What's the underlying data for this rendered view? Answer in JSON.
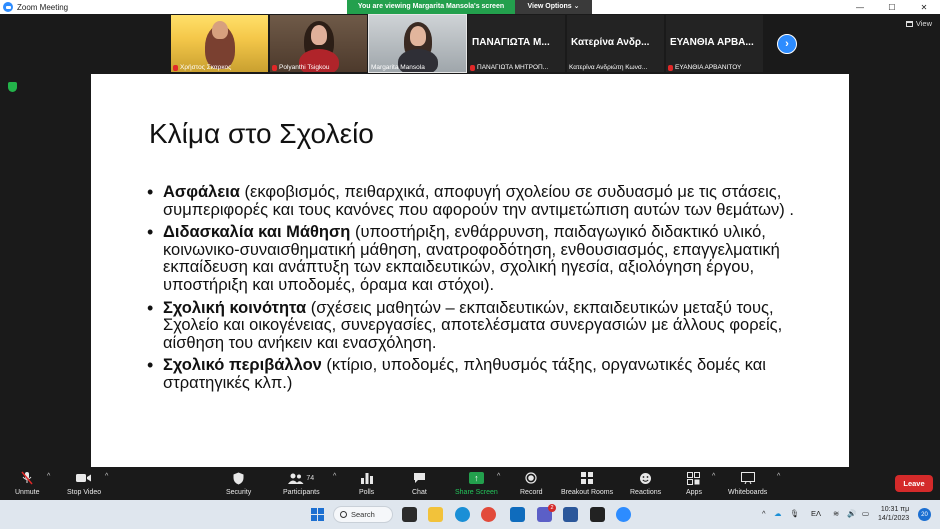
{
  "window": {
    "title": "Zoom Meeting",
    "controls": [
      "—",
      "☐",
      "✕"
    ]
  },
  "share_banner": {
    "text": "You are viewing Margarita Mansola's screen",
    "view_options": "View Options ⌄"
  },
  "view_button": "View",
  "participants": [
    {
      "name": "Χρήστος Σκαρκος",
      "muted": true,
      "type": "video"
    },
    {
      "name": "Polyanthi Tsigkou",
      "muted": true,
      "type": "video"
    },
    {
      "name": "Margarita Mansola",
      "muted": false,
      "type": "video"
    },
    {
      "big": "ΠΑΝΑΓΙΩΤΑ  Μ...",
      "name": "ΠΑΝΑΓΙΩΤΑ ΜΗΤΡΟΠ...",
      "muted": true,
      "type": "name"
    },
    {
      "big": "Κατερίνα Ανδρ...",
      "name": "Κατερίνα Ανδριώτη Κωνσ...",
      "muted": false,
      "type": "name"
    },
    {
      "big": "ΕΥΑΝΘΙΑ  ΑΡΒΑ...",
      "name": "ΕΥΑΝΘΙΑ ΑΡΒΑΝΙΤΟΥ",
      "muted": true,
      "type": "name"
    }
  ],
  "slide": {
    "title": "Κλίμα στο Σχολείο",
    "bullets": [
      {
        "head": "Ασφάλεια",
        "body": " (εκφοβισμός, πειθαρχικά,  αποφυγή σχολείου σε συδυασμό με τις  στάσεις, συμπεριφορές και τους κανόνες που αφορούν την αντιμετώπιση αυτών των θεμάτων) ."
      },
      {
        "head": "Διδασκαλία και Μάθηση",
        "body": " (υποστήριξη, ενθάρρυνση,  παιδαγωγικό διδακτικό υλικό, κοινωνικο-συναισθηματική μάθηση, ανατροφοδότηση, ενθουσιασμός, επαγγελματική εκπαίδευση και ανάπτυξη των εκπαιδευτικών,  σχολική ηγεσία,  αξιολόγηση έργου, υποστήριξη και υποδομές, όραμα και στόχοι)."
      },
      {
        "head": "Σχολική κοινότητα",
        "body": " (σχέσεις μαθητών – εκπαιδευτικών, εκπαιδευτικών μεταξύ τους, Σχολείο και οικογένειας,  συνεργασίες, αποτελέσματα συνεργασιών με άλλους φορείς, αίσθηση του ανήκειν και ενασχόληση."
      },
      {
        "head": "Σχολικό περιβάλλον",
        "body": "  (κτίριο, υποδομές, πληθυσμός τάξης,  οργανωτικές δομές και στρατηγικές  κλπ.)"
      }
    ]
  },
  "toolbar": {
    "unmute": "Unmute",
    "stop_video": "Stop Video",
    "security": "Security",
    "participants": "Participants",
    "participants_count": "74",
    "polls": "Polls",
    "chat": "Chat",
    "share_screen": "Share Screen",
    "record": "Record",
    "breakout_rooms": "Breakout Rooms",
    "reactions": "Reactions",
    "apps": "Apps",
    "whiteboards": "Whiteboards",
    "leave": "Leave"
  },
  "taskbar": {
    "search": "Search",
    "language": "ΕΛ",
    "time": "10:31 πμ",
    "date": "14/1/2023",
    "notifications": "20",
    "teams_badge": "2"
  },
  "colors": {
    "zoom_blue": "#2d8cff",
    "share_green": "#23a04d",
    "leave_red": "#d42a2a"
  }
}
